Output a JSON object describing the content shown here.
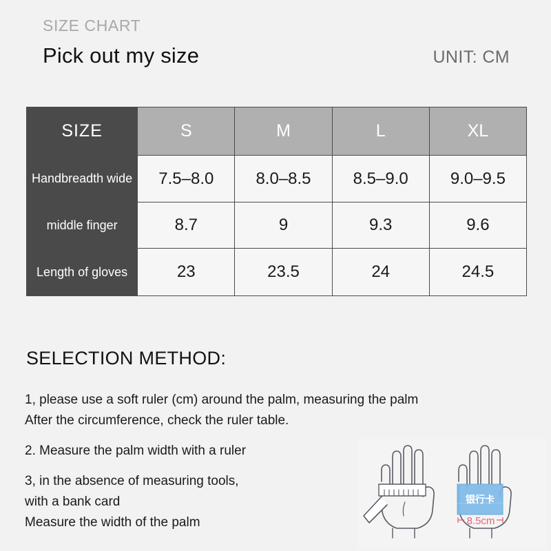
{
  "header": {
    "eyebrow": "SIZE CHART",
    "title": "Pick out my size",
    "unit": "UNIT: CM"
  },
  "table": {
    "corner_label": "SIZE",
    "size_columns": [
      "S",
      "M",
      "L",
      "XL"
    ],
    "rows": [
      {
        "label": "Handbreadth wide",
        "label_line1": "Handbreadth",
        "label_line2": "wide",
        "values": [
          "7.5–8.0",
          "8.0–8.5",
          "8.5–9.0",
          "9.0–9.5"
        ]
      },
      {
        "label": "middle finger",
        "label_line1": "middle finger",
        "label_line2": "",
        "values": [
          "8.7",
          "9",
          "9.3",
          "9.6"
        ]
      },
      {
        "label": "Length of gloves",
        "label_line1": "Length of",
        "label_line2": "gloves",
        "values": [
          "23",
          "23.5",
          "24",
          "24.5"
        ]
      }
    ]
  },
  "selection": {
    "heading": "SELECTION METHOD:",
    "steps": [
      {
        "line1": "1, please use a soft ruler (cm) around the palm, measuring the palm",
        "line2": "After the circumference, check the ruler table.",
        "line3": ""
      },
      {
        "line1": "2. Measure the palm width with a ruler",
        "line2": "",
        "line3": ""
      },
      {
        "line1": "3, in the absence of measuring tools,",
        "line2": "with a bank card",
        "line3": "Measure the width of the palm"
      }
    ]
  },
  "illustration": {
    "card_label": "银行卡",
    "card_measure": "8.5cm",
    "card_color": "#7db9e8",
    "measure_color": "#e8607a"
  },
  "colors": {
    "background": "#f2f2f2",
    "header_dark": "#4a4a4a",
    "header_light": "#b0b0b0",
    "cell_light": "#f6f6f6",
    "eyebrow_gray": "#a8a8a8",
    "unit_gray": "#6b6b6b"
  }
}
